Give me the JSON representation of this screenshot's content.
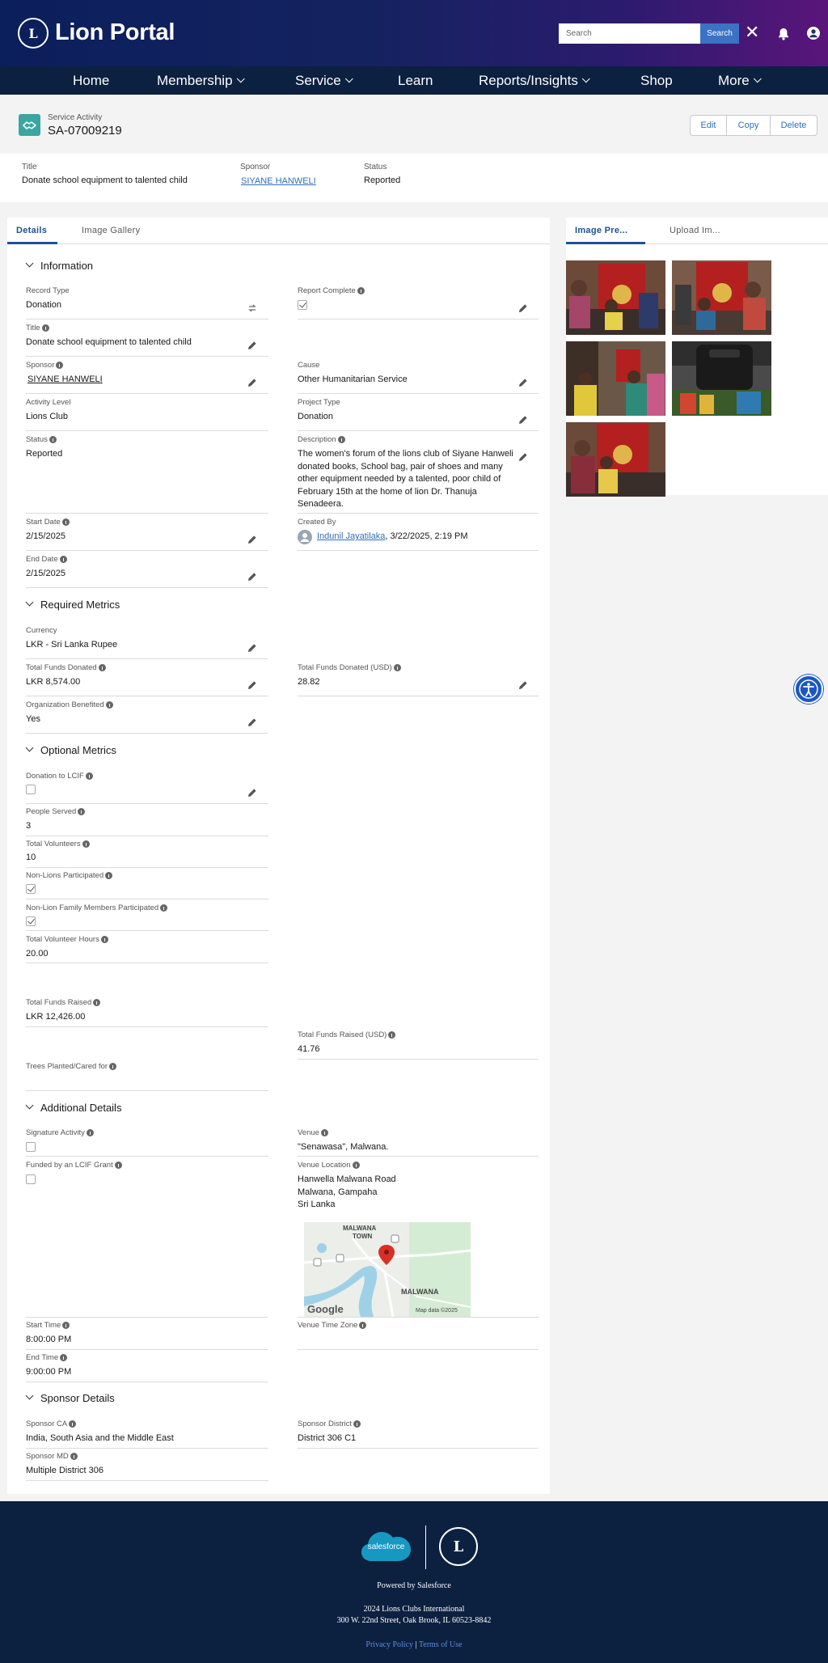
{
  "header": {
    "brand": "Lion Portal",
    "logo_letter": "L",
    "search_placeholder": "Search",
    "search_button": "Search"
  },
  "nav": {
    "items": [
      {
        "label": "Home",
        "chevron": false
      },
      {
        "label": "Membership",
        "chevron": true
      },
      {
        "label": "Service",
        "chevron": true
      },
      {
        "label": "Learn",
        "chevron": false
      },
      {
        "label": "Reports/Insights",
        "chevron": true
      },
      {
        "label": "Shop",
        "chevron": false
      },
      {
        "label": "More",
        "chevron": true
      }
    ]
  },
  "record": {
    "type": "Service Activity",
    "name": "SA-07009219",
    "actions": {
      "edit": "Edit",
      "copy": "Copy",
      "delete": "Delete"
    }
  },
  "highlights": {
    "title_label": "Title",
    "title_value": "Donate school equipment to talented child",
    "sponsor_label": "Sponsor",
    "sponsor_value": "SIYANE HANWELI",
    "status_label": "Status",
    "status_value": "Reported"
  },
  "tabs": {
    "details": "Details",
    "gallery": "Image Gallery"
  },
  "sections": {
    "information": "Information",
    "required": "Required Metrics",
    "optional": "Optional Metrics",
    "additional": "Additional Details",
    "sponsor": "Sponsor Details"
  },
  "fields": {
    "record_type": {
      "label": "Record Type",
      "value": "Donation"
    },
    "report_complete": {
      "label": "Report Complete",
      "checked": true
    },
    "title": {
      "label": "Title",
      "value": "Donate school equipment to talented child"
    },
    "sponsor": {
      "label": "Sponsor",
      "value": "SIYANE HANWELI"
    },
    "cause": {
      "label": "Cause",
      "value": "Other Humanitarian Service"
    },
    "activity_level": {
      "label": "Activity Level",
      "value": "Lions Club"
    },
    "project_type": {
      "label": "Project Type",
      "value": "Donation"
    },
    "status": {
      "label": "Status",
      "value": "Reported"
    },
    "description": {
      "label": "Description",
      "lines": [
        "The women's forum of the lions club of Siyane Hanweli",
        "donated books, School bag, pair of shoes and many",
        "other equipment needed by a talented, poor child of",
        "February 15th at the home of lion Dr. Thanuja",
        "Senadeera."
      ]
    },
    "start_date": {
      "label": "Start Date",
      "value": "2/15/2025"
    },
    "created_by": {
      "label": "Created By",
      "user": "Indunil Jayatilaka",
      "date": ", 3/22/2025, 2:19 PM"
    },
    "end_date": {
      "label": "End Date",
      "value": "2/15/2025"
    },
    "currency": {
      "label": "Currency",
      "value": "LKR - Sri Lanka Rupee"
    },
    "total_funds_donated": {
      "label": "Total Funds Donated",
      "value": "LKR 8,574.00"
    },
    "total_funds_donated_usd": {
      "label": "Total Funds Donated (USD)",
      "value": "28.82"
    },
    "org_benefited": {
      "label": "Organization Benefited",
      "value": "Yes"
    },
    "donation_lcif": {
      "label": "Donation to LCIF",
      "checked": false
    },
    "people_served": {
      "label": "People Served",
      "value": "3"
    },
    "total_volunteers": {
      "label": "Total Volunteers",
      "value": "10"
    },
    "non_lions": {
      "label": "Non-Lions Participated",
      "checked": true
    },
    "non_lion_family": {
      "label": "Non-Lion Family Members Participated",
      "checked": true
    },
    "volunteer_hours": {
      "label": "Total Volunteer Hours",
      "value": "20.00"
    },
    "funds_raised": {
      "label": "Total Funds Raised",
      "value": "LKR 12,426.00"
    },
    "funds_raised_usd": {
      "label": "Total Funds Raised (USD)",
      "value": "41.76"
    },
    "trees": {
      "label": "Trees Planted/Cared for",
      "value": ""
    },
    "signature_activity": {
      "label": "Signature Activity",
      "checked": false
    },
    "venue": {
      "label": "Venue",
      "value": "\"Senawasa\", Malwana."
    },
    "lcif_grant": {
      "label": "Funded by an LCIF Grant",
      "checked": false
    },
    "venue_location": {
      "label": "Venue Location",
      "lines": [
        "Hanwella Malwana Road",
        "Malwana, Gampaha",
        "Sri Lanka"
      ]
    },
    "start_time": {
      "label": "Start Time",
      "value": "8:00:00 PM"
    },
    "venue_tz": {
      "label": "Venue Time Zone",
      "value": ""
    },
    "end_time": {
      "label": "End Time",
      "value": "9:00:00 PM"
    },
    "sponsor_ca": {
      "label": "Sponsor CA",
      "value": "India, South Asia and the Middle East"
    },
    "sponsor_district": {
      "label": "Sponsor District",
      "value": "District 306 C1"
    },
    "sponsor_md": {
      "label": "Sponsor MD",
      "value": "Multiple District 306"
    }
  },
  "map": {
    "labels": [
      "MALWANA",
      "TOWN",
      "MALWANA"
    ],
    "google": "Google",
    "attribution": "Map data ©2025"
  },
  "side": {
    "tab1": "Image Pre...",
    "tab2": "Upload Im..."
  },
  "footer": {
    "salesforce": "salesforce",
    "powered": "Powered by Salesforce",
    "org": "2024 Lions Clubs International",
    "address": "300 W. 22nd Street, Oak Brook, IL 60523-8842",
    "privacy": "Privacy Policy",
    "sep": " | ",
    "terms": "Terms of Use",
    "logo_letter": "L"
  },
  "colors": {
    "accent": "#3b72c4",
    "nav_bg": "#0c2040",
    "link": "#2f6fba",
    "record_icon": "#3aa6a0"
  }
}
